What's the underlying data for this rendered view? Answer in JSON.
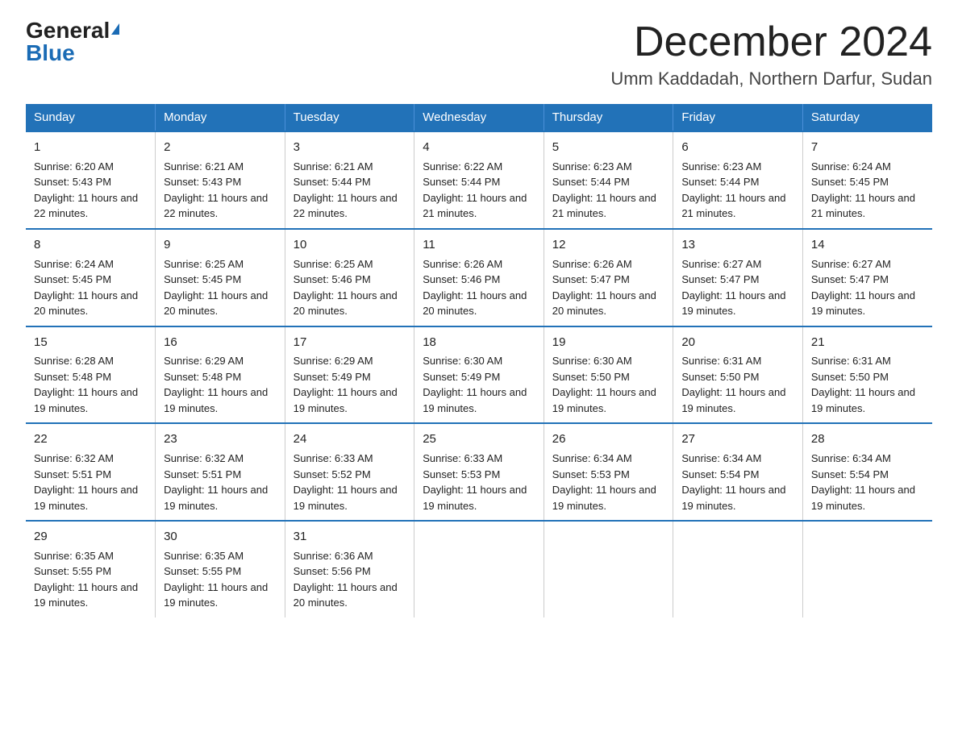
{
  "header": {
    "logo_general": "General",
    "logo_blue": "Blue",
    "title": "December 2024",
    "subtitle": "Umm Kaddadah, Northern Darfur, Sudan"
  },
  "columns": [
    "Sunday",
    "Monday",
    "Tuesday",
    "Wednesday",
    "Thursday",
    "Friday",
    "Saturday"
  ],
  "weeks": [
    [
      {
        "day": "1",
        "sunrise": "Sunrise: 6:20 AM",
        "sunset": "Sunset: 5:43 PM",
        "daylight": "Daylight: 11 hours and 22 minutes."
      },
      {
        "day": "2",
        "sunrise": "Sunrise: 6:21 AM",
        "sunset": "Sunset: 5:43 PM",
        "daylight": "Daylight: 11 hours and 22 minutes."
      },
      {
        "day": "3",
        "sunrise": "Sunrise: 6:21 AM",
        "sunset": "Sunset: 5:44 PM",
        "daylight": "Daylight: 11 hours and 22 minutes."
      },
      {
        "day": "4",
        "sunrise": "Sunrise: 6:22 AM",
        "sunset": "Sunset: 5:44 PM",
        "daylight": "Daylight: 11 hours and 21 minutes."
      },
      {
        "day": "5",
        "sunrise": "Sunrise: 6:23 AM",
        "sunset": "Sunset: 5:44 PM",
        "daylight": "Daylight: 11 hours and 21 minutes."
      },
      {
        "day": "6",
        "sunrise": "Sunrise: 6:23 AM",
        "sunset": "Sunset: 5:44 PM",
        "daylight": "Daylight: 11 hours and 21 minutes."
      },
      {
        "day": "7",
        "sunrise": "Sunrise: 6:24 AM",
        "sunset": "Sunset: 5:45 PM",
        "daylight": "Daylight: 11 hours and 21 minutes."
      }
    ],
    [
      {
        "day": "8",
        "sunrise": "Sunrise: 6:24 AM",
        "sunset": "Sunset: 5:45 PM",
        "daylight": "Daylight: 11 hours and 20 minutes."
      },
      {
        "day": "9",
        "sunrise": "Sunrise: 6:25 AM",
        "sunset": "Sunset: 5:45 PM",
        "daylight": "Daylight: 11 hours and 20 minutes."
      },
      {
        "day": "10",
        "sunrise": "Sunrise: 6:25 AM",
        "sunset": "Sunset: 5:46 PM",
        "daylight": "Daylight: 11 hours and 20 minutes."
      },
      {
        "day": "11",
        "sunrise": "Sunrise: 6:26 AM",
        "sunset": "Sunset: 5:46 PM",
        "daylight": "Daylight: 11 hours and 20 minutes."
      },
      {
        "day": "12",
        "sunrise": "Sunrise: 6:26 AM",
        "sunset": "Sunset: 5:47 PM",
        "daylight": "Daylight: 11 hours and 20 minutes."
      },
      {
        "day": "13",
        "sunrise": "Sunrise: 6:27 AM",
        "sunset": "Sunset: 5:47 PM",
        "daylight": "Daylight: 11 hours and 19 minutes."
      },
      {
        "day": "14",
        "sunrise": "Sunrise: 6:27 AM",
        "sunset": "Sunset: 5:47 PM",
        "daylight": "Daylight: 11 hours and 19 minutes."
      }
    ],
    [
      {
        "day": "15",
        "sunrise": "Sunrise: 6:28 AM",
        "sunset": "Sunset: 5:48 PM",
        "daylight": "Daylight: 11 hours and 19 minutes."
      },
      {
        "day": "16",
        "sunrise": "Sunrise: 6:29 AM",
        "sunset": "Sunset: 5:48 PM",
        "daylight": "Daylight: 11 hours and 19 minutes."
      },
      {
        "day": "17",
        "sunrise": "Sunrise: 6:29 AM",
        "sunset": "Sunset: 5:49 PM",
        "daylight": "Daylight: 11 hours and 19 minutes."
      },
      {
        "day": "18",
        "sunrise": "Sunrise: 6:30 AM",
        "sunset": "Sunset: 5:49 PM",
        "daylight": "Daylight: 11 hours and 19 minutes."
      },
      {
        "day": "19",
        "sunrise": "Sunrise: 6:30 AM",
        "sunset": "Sunset: 5:50 PM",
        "daylight": "Daylight: 11 hours and 19 minutes."
      },
      {
        "day": "20",
        "sunrise": "Sunrise: 6:31 AM",
        "sunset": "Sunset: 5:50 PM",
        "daylight": "Daylight: 11 hours and 19 minutes."
      },
      {
        "day": "21",
        "sunrise": "Sunrise: 6:31 AM",
        "sunset": "Sunset: 5:50 PM",
        "daylight": "Daylight: 11 hours and 19 minutes."
      }
    ],
    [
      {
        "day": "22",
        "sunrise": "Sunrise: 6:32 AM",
        "sunset": "Sunset: 5:51 PM",
        "daylight": "Daylight: 11 hours and 19 minutes."
      },
      {
        "day": "23",
        "sunrise": "Sunrise: 6:32 AM",
        "sunset": "Sunset: 5:51 PM",
        "daylight": "Daylight: 11 hours and 19 minutes."
      },
      {
        "day": "24",
        "sunrise": "Sunrise: 6:33 AM",
        "sunset": "Sunset: 5:52 PM",
        "daylight": "Daylight: 11 hours and 19 minutes."
      },
      {
        "day": "25",
        "sunrise": "Sunrise: 6:33 AM",
        "sunset": "Sunset: 5:53 PM",
        "daylight": "Daylight: 11 hours and 19 minutes."
      },
      {
        "day": "26",
        "sunrise": "Sunrise: 6:34 AM",
        "sunset": "Sunset: 5:53 PM",
        "daylight": "Daylight: 11 hours and 19 minutes."
      },
      {
        "day": "27",
        "sunrise": "Sunrise: 6:34 AM",
        "sunset": "Sunset: 5:54 PM",
        "daylight": "Daylight: 11 hours and 19 minutes."
      },
      {
        "day": "28",
        "sunrise": "Sunrise: 6:34 AM",
        "sunset": "Sunset: 5:54 PM",
        "daylight": "Daylight: 11 hours and 19 minutes."
      }
    ],
    [
      {
        "day": "29",
        "sunrise": "Sunrise: 6:35 AM",
        "sunset": "Sunset: 5:55 PM",
        "daylight": "Daylight: 11 hours and 19 minutes."
      },
      {
        "day": "30",
        "sunrise": "Sunrise: 6:35 AM",
        "sunset": "Sunset: 5:55 PM",
        "daylight": "Daylight: 11 hours and 19 minutes."
      },
      {
        "day": "31",
        "sunrise": "Sunrise: 6:36 AM",
        "sunset": "Sunset: 5:56 PM",
        "daylight": "Daylight: 11 hours and 20 minutes."
      },
      null,
      null,
      null,
      null
    ]
  ]
}
